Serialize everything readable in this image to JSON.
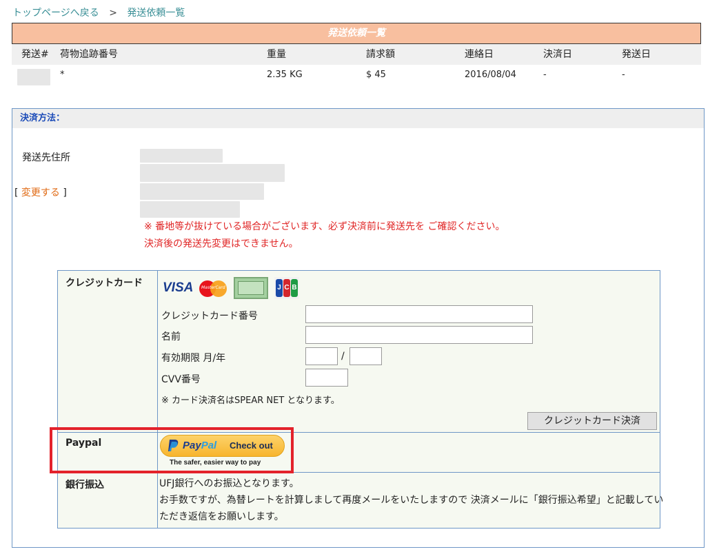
{
  "breadcrumb": {
    "home": "トップページへ戻る",
    "separator": ">",
    "current": "発送依頼一覧"
  },
  "list": {
    "header": "発送依頼一覧",
    "columns": [
      "発送#",
      "荷物追跡番号",
      "重量",
      "請求額",
      "連絡日",
      "決済日",
      "発送日"
    ],
    "rows": [
      {
        "tracking": "*",
        "weight": "2.35 KG",
        "amount": "$ 45",
        "contact_date": "2016/08/04",
        "payment_date": "-",
        "ship_date": "-"
      }
    ]
  },
  "payment": {
    "title": "決済方法：",
    "address_label": "発送先住所",
    "change_open": "[",
    "change_link": "変更する",
    "change_close": "]",
    "warning_line1": "※ 番地等が抜けている場合がございます、必ず決済前に発送先を ご確認ください。",
    "warning_line2": "決済後の発送先変更はできません。"
  },
  "credit": {
    "label": "クレジットカード",
    "card_logos": [
      "VISA",
      "MasterCard",
      "American Express",
      "JCB"
    ],
    "visa_text": "VISA",
    "mc_text": "MasterCard",
    "jcb_letters": [
      "J",
      "C",
      "B"
    ],
    "number_label": "クレジットカード番号",
    "name_label": "名前",
    "expiry_label": "有効期限 月/年",
    "expiry_separator": "/",
    "cvv_label": "CVV番号",
    "note": "※ カード決済名はSPEAR NET となります。",
    "submit": "クレジットカード決済"
  },
  "paypal": {
    "label": "Paypal",
    "logo_pay": "Pay",
    "logo_pal": "Pal",
    "button_text": "Check out",
    "tagline": "The safer, easier way to pay"
  },
  "bank": {
    "label": "銀行振込",
    "line1": "UFJ銀行へのお振込となります。",
    "line2": "お手数ですが、為替レートを計算しまして再度メールをいたしますので 決済メールに「銀行振込希望」と記載してい",
    "line3": "ただき返信をお願いします。"
  },
  "colors": {
    "accent_header": "#f8bf9f",
    "border_blue": "#6d96c6",
    "link_teal": "#3a8f96",
    "warning_red": "#e02525",
    "highlight_red": "#e3222b"
  }
}
